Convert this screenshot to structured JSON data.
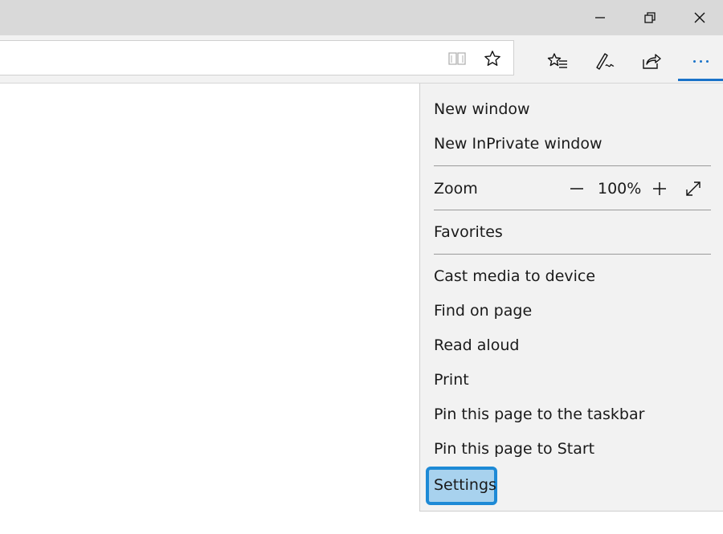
{
  "window": {
    "minimize_icon": "minimize-icon",
    "restore_icon": "restore-icon",
    "close_icon": "close-icon"
  },
  "toolbar": {
    "reading_view_icon": "book-icon",
    "favorite_star_icon": "star-icon",
    "hub_icon": "favorites-hub-icon",
    "notes_icon": "pen-icon",
    "share_icon": "share-icon",
    "more_icon": "more-dots-icon",
    "accent_color": "#1a73c9"
  },
  "menu": {
    "new_window": "New window",
    "new_inprivate": "New InPrivate window",
    "zoom_label": "Zoom",
    "zoom_value": "100%",
    "favorites": "Favorites",
    "cast": "Cast media to device",
    "find": "Find on page",
    "read_aloud": "Read aloud",
    "print": "Print",
    "pin_taskbar": "Pin this page to the taskbar",
    "pin_start": "Pin this page to Start",
    "settings": "Settings",
    "highlight_color": "#1e8ad6"
  }
}
